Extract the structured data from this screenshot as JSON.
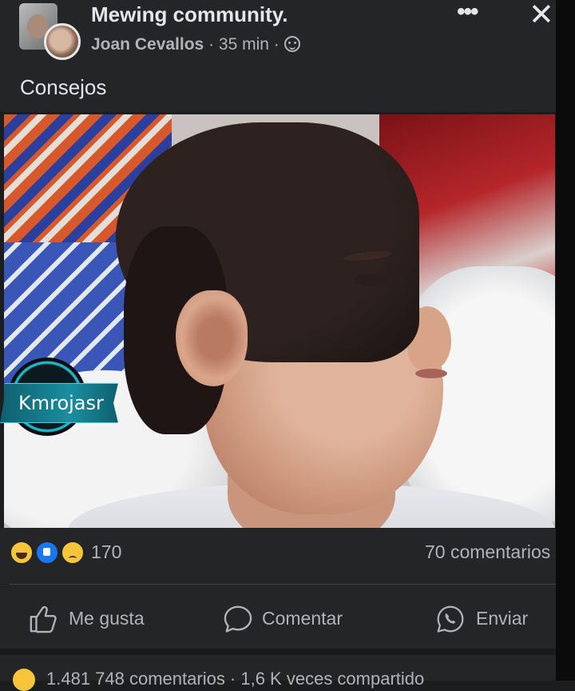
{
  "post": {
    "group_name": "Mewing community.",
    "author": "Joan Cevallos",
    "time": " · 35 min · ",
    "caption": "Consejos"
  },
  "watermark": {
    "text": "Kmrojasr"
  },
  "reactions": {
    "count": "170",
    "comments": "70 comentarios"
  },
  "actions": {
    "like": "Me gusta",
    "comment": "Comentar",
    "send": "Enviar"
  },
  "next_post": {
    "summary": "1.481          748 comentarios · 1,6 K veces compartido"
  },
  "colors": {
    "background": "#242527",
    "text_primary": "#e4e6eb",
    "text_secondary": "#b0b3b8",
    "like_blue": "#1877f2",
    "emoji_yellow": "#f7c53c"
  }
}
